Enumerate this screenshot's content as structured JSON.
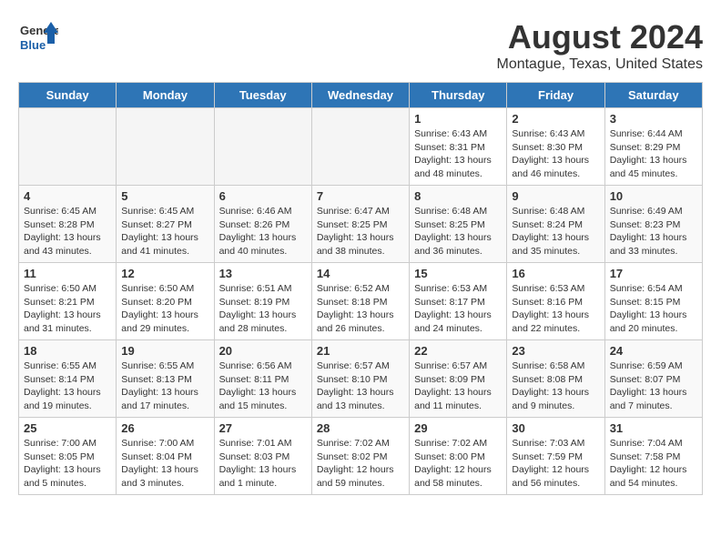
{
  "logo": {
    "line1": "General",
    "line2": "Blue"
  },
  "title": "August 2024",
  "location": "Montague, Texas, United States",
  "weekdays": [
    "Sunday",
    "Monday",
    "Tuesday",
    "Wednesday",
    "Thursday",
    "Friday",
    "Saturday"
  ],
  "weeks": [
    [
      {
        "day": "",
        "info": ""
      },
      {
        "day": "",
        "info": ""
      },
      {
        "day": "",
        "info": ""
      },
      {
        "day": "",
        "info": ""
      },
      {
        "day": "1",
        "info": "Sunrise: 6:43 AM\nSunset: 8:31 PM\nDaylight: 13 hours\nand 48 minutes."
      },
      {
        "day": "2",
        "info": "Sunrise: 6:43 AM\nSunset: 8:30 PM\nDaylight: 13 hours\nand 46 minutes."
      },
      {
        "day": "3",
        "info": "Sunrise: 6:44 AM\nSunset: 8:29 PM\nDaylight: 13 hours\nand 45 minutes."
      }
    ],
    [
      {
        "day": "4",
        "info": "Sunrise: 6:45 AM\nSunset: 8:28 PM\nDaylight: 13 hours\nand 43 minutes."
      },
      {
        "day": "5",
        "info": "Sunrise: 6:45 AM\nSunset: 8:27 PM\nDaylight: 13 hours\nand 41 minutes."
      },
      {
        "day": "6",
        "info": "Sunrise: 6:46 AM\nSunset: 8:26 PM\nDaylight: 13 hours\nand 40 minutes."
      },
      {
        "day": "7",
        "info": "Sunrise: 6:47 AM\nSunset: 8:25 PM\nDaylight: 13 hours\nand 38 minutes."
      },
      {
        "day": "8",
        "info": "Sunrise: 6:48 AM\nSunset: 8:25 PM\nDaylight: 13 hours\nand 36 minutes."
      },
      {
        "day": "9",
        "info": "Sunrise: 6:48 AM\nSunset: 8:24 PM\nDaylight: 13 hours\nand 35 minutes."
      },
      {
        "day": "10",
        "info": "Sunrise: 6:49 AM\nSunset: 8:23 PM\nDaylight: 13 hours\nand 33 minutes."
      }
    ],
    [
      {
        "day": "11",
        "info": "Sunrise: 6:50 AM\nSunset: 8:21 PM\nDaylight: 13 hours\nand 31 minutes."
      },
      {
        "day": "12",
        "info": "Sunrise: 6:50 AM\nSunset: 8:20 PM\nDaylight: 13 hours\nand 29 minutes."
      },
      {
        "day": "13",
        "info": "Sunrise: 6:51 AM\nSunset: 8:19 PM\nDaylight: 13 hours\nand 28 minutes."
      },
      {
        "day": "14",
        "info": "Sunrise: 6:52 AM\nSunset: 8:18 PM\nDaylight: 13 hours\nand 26 minutes."
      },
      {
        "day": "15",
        "info": "Sunrise: 6:53 AM\nSunset: 8:17 PM\nDaylight: 13 hours\nand 24 minutes."
      },
      {
        "day": "16",
        "info": "Sunrise: 6:53 AM\nSunset: 8:16 PM\nDaylight: 13 hours\nand 22 minutes."
      },
      {
        "day": "17",
        "info": "Sunrise: 6:54 AM\nSunset: 8:15 PM\nDaylight: 13 hours\nand 20 minutes."
      }
    ],
    [
      {
        "day": "18",
        "info": "Sunrise: 6:55 AM\nSunset: 8:14 PM\nDaylight: 13 hours\nand 19 minutes."
      },
      {
        "day": "19",
        "info": "Sunrise: 6:55 AM\nSunset: 8:13 PM\nDaylight: 13 hours\nand 17 minutes."
      },
      {
        "day": "20",
        "info": "Sunrise: 6:56 AM\nSunset: 8:11 PM\nDaylight: 13 hours\nand 15 minutes."
      },
      {
        "day": "21",
        "info": "Sunrise: 6:57 AM\nSunset: 8:10 PM\nDaylight: 13 hours\nand 13 minutes."
      },
      {
        "day": "22",
        "info": "Sunrise: 6:57 AM\nSunset: 8:09 PM\nDaylight: 13 hours\nand 11 minutes."
      },
      {
        "day": "23",
        "info": "Sunrise: 6:58 AM\nSunset: 8:08 PM\nDaylight: 13 hours\nand 9 minutes."
      },
      {
        "day": "24",
        "info": "Sunrise: 6:59 AM\nSunset: 8:07 PM\nDaylight: 13 hours\nand 7 minutes."
      }
    ],
    [
      {
        "day": "25",
        "info": "Sunrise: 7:00 AM\nSunset: 8:05 PM\nDaylight: 13 hours\nand 5 minutes."
      },
      {
        "day": "26",
        "info": "Sunrise: 7:00 AM\nSunset: 8:04 PM\nDaylight: 13 hours\nand 3 minutes."
      },
      {
        "day": "27",
        "info": "Sunrise: 7:01 AM\nSunset: 8:03 PM\nDaylight: 13 hours\nand 1 minute."
      },
      {
        "day": "28",
        "info": "Sunrise: 7:02 AM\nSunset: 8:02 PM\nDaylight: 12 hours\nand 59 minutes."
      },
      {
        "day": "29",
        "info": "Sunrise: 7:02 AM\nSunset: 8:00 PM\nDaylight: 12 hours\nand 58 minutes."
      },
      {
        "day": "30",
        "info": "Sunrise: 7:03 AM\nSunset: 7:59 PM\nDaylight: 12 hours\nand 56 minutes."
      },
      {
        "day": "31",
        "info": "Sunrise: 7:04 AM\nSunset: 7:58 PM\nDaylight: 12 hours\nand 54 minutes."
      }
    ]
  ]
}
